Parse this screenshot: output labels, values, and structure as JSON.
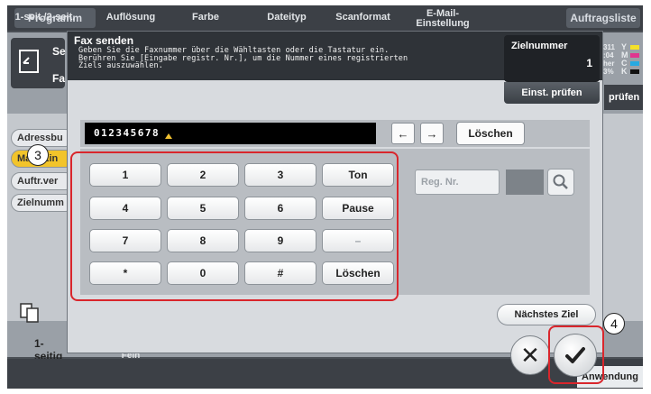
{
  "top_bar": {
    "left_tab": "Programm",
    "right_tab": "Auftragsliste"
  },
  "left_panel": {
    "fax_mode_label_1": "Se",
    "fax_mode_label_2": "Fa",
    "side_items": [
      "Adressbu",
      "Man. Ein",
      "Auftr.ver",
      "Zielnumm"
    ],
    "duplex_label": "1-seitig"
  },
  "right_panel": {
    "info_lines": [
      "311",
      ":04",
      "her",
      "3%"
    ],
    "cmyk": [
      "Y",
      "M",
      "C",
      "K"
    ],
    "pruefen": "prüfen"
  },
  "dialog": {
    "title": "Fax senden",
    "instruction": "Geben Sie die Faxnummer über die Wähltasten oder die Tastatur ein. Berühren Sie [Eingabe registr. Nr.], um die Nummer eines registrierten Ziels auszuwählen.",
    "ziel_label": "Zielnummer",
    "ziel_value": "1",
    "einst_pruefen": "Einst. prüfen",
    "fax_number": "012345678",
    "arrow_left": "←",
    "arrow_right": "→",
    "loeschen_top": "Löschen",
    "keys": [
      [
        "1",
        "2",
        "3",
        "Ton"
      ],
      [
        "4",
        "5",
        "6",
        "Pause"
      ],
      [
        "7",
        "8",
        "9",
        "–"
      ],
      [
        "*",
        "0",
        "#",
        "Löschen"
      ]
    ],
    "reg_nr_placeholder": "Reg. Nr.",
    "next_target": "Nächstes Ziel"
  },
  "bottom_bar": {
    "labels": [
      "1-seit./2-seit.",
      "Auflösung",
      "Farbe",
      "Dateityp",
      "Scanformat",
      "E-Mail-\nEinstellung",
      "Anwendung"
    ],
    "fein_partial": "Fein"
  },
  "callouts": [
    "3",
    "4"
  ],
  "colors": {
    "highlight": "#d9262c",
    "cursor": "#f0c030",
    "dialog_header": "#2f3338"
  }
}
